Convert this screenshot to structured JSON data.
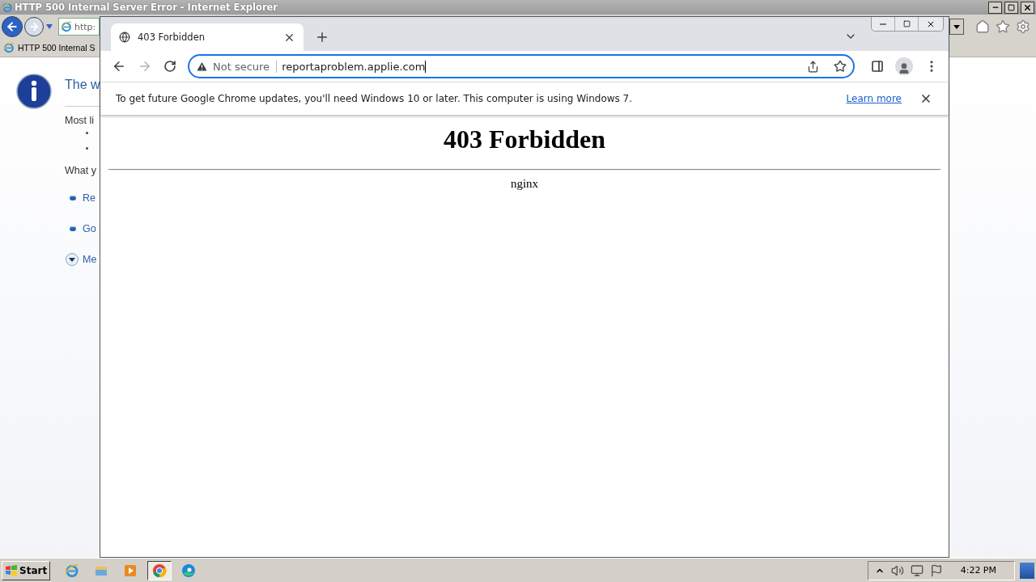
{
  "ie_window": {
    "title": "HTTP 500 Internal Server Error - Internet Explorer",
    "address": "http:",
    "tab": "HTTP 500 Internal S",
    "heading": "The w",
    "section_1": "Most li",
    "section_2": "What y",
    "links": [
      {
        "label": "Re",
        "kind": "bullet"
      },
      {
        "label": "Go",
        "kind": "bullet"
      },
      {
        "label": "Me",
        "kind": "expand"
      }
    ]
  },
  "chrome_window": {
    "tabs": [
      {
        "title": "403 Forbidden",
        "selected": true
      }
    ],
    "forward_disabled": true,
    "omnibox": {
      "security": "Not secure",
      "url": "reportaproblem.applie.com",
      "focused": true
    },
    "infobar": {
      "message": "To get future Google Chrome updates, you'll need Windows 10 or later. This computer is using Windows 7.",
      "link": "Learn more"
    },
    "page": {
      "heading": "403 Forbidden",
      "footer": "nginx"
    }
  },
  "taskbar": {
    "start": "Start",
    "apps": [
      {
        "kind": "ie",
        "selected": false
      },
      {
        "kind": "explorer",
        "selected": false
      },
      {
        "kind": "media",
        "selected": false
      },
      {
        "kind": "chrome",
        "selected": true
      },
      {
        "kind": "edge",
        "selected": false
      }
    ],
    "clock": "4:22 PM"
  }
}
